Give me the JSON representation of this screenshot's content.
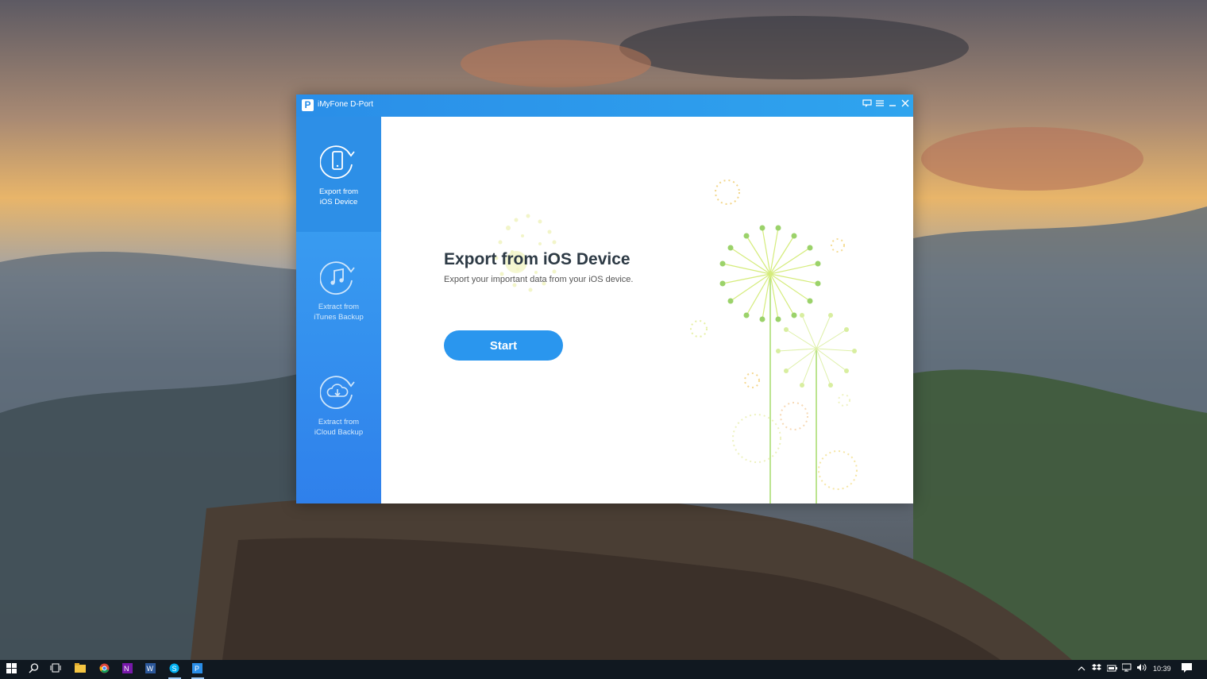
{
  "window": {
    "title": "iMyFone D-Port",
    "logo_letter": "P"
  },
  "title_controls": {
    "feedback_icon": "feedback-icon",
    "menu_icon": "menu-icon",
    "minimize_icon": "minimize-icon",
    "close_icon": "close-icon"
  },
  "sidebar": {
    "items": [
      {
        "label": "Export from\niOS Device",
        "icon": "phone-export-icon",
        "active": true
      },
      {
        "label": "Extract from\niTunes Backup",
        "icon": "music-note-icon",
        "active": false
      },
      {
        "label": "Extract from\niCloud Backup",
        "icon": "cloud-download-icon",
        "active": false
      }
    ]
  },
  "main": {
    "title": "Export from iOS Device",
    "subtitle": "Export your important data from your iOS device.",
    "start_label": "Start"
  },
  "taskbar": {
    "time": "10:39",
    "apps": [
      "windows-start-icon",
      "search-icon",
      "task-view-icon",
      "file-explorer-icon",
      "chrome-icon",
      "onenote-icon",
      "word-icon",
      "skype-icon",
      "dport-icon"
    ]
  },
  "colors": {
    "accent": "#2a96ee",
    "sidebar_active": "#2d8fe7",
    "title_text": "#2d3a45"
  }
}
